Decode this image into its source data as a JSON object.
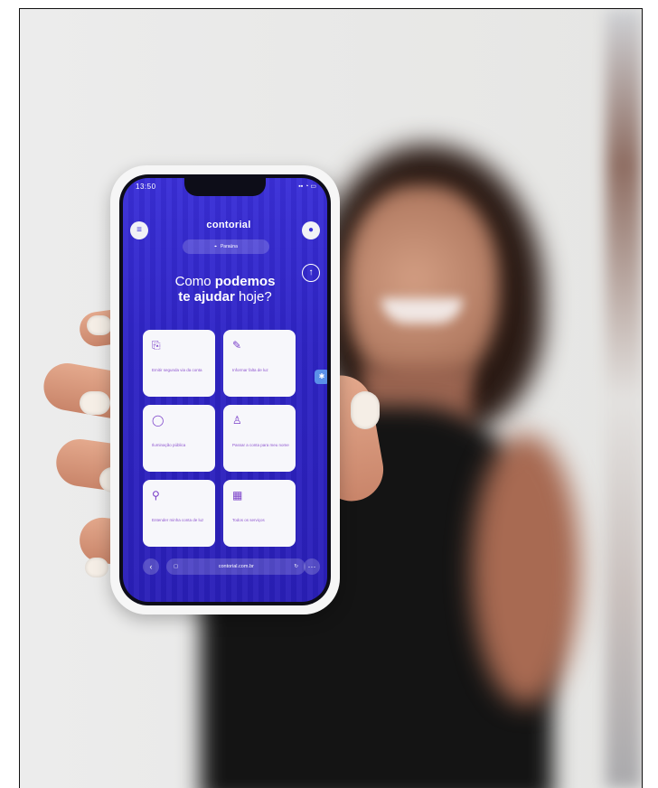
{
  "status_bar": {
    "time": "13:50",
    "icons": "▪▪ ◔ ▭"
  },
  "app": {
    "logo": "contorial",
    "location": "Paraúna",
    "headline_prefix": "Como",
    "headline_bold1": "podemos",
    "headline_bold2": "te ajudar",
    "headline_suffix": "hoje?"
  },
  "cards": [
    {
      "icon": "document-icon",
      "label": "Emitir segunda via da conta"
    },
    {
      "icon": "wrench-icon",
      "label": "Informar falta de luz"
    },
    {
      "icon": "lightbulb-icon",
      "label": "Iluminação pública"
    },
    {
      "icon": "people-icon",
      "label": "Passar a conta para meu nome"
    },
    {
      "icon": "pin-icon",
      "label": "Entender minha conta de luz"
    },
    {
      "icon": "grid-icon",
      "label": "Todos os serviços"
    }
  ],
  "browser": {
    "url": "contorial.com.br"
  },
  "colors": {
    "screen_bg": "#3a2fd8",
    "card_bg": "#f7f7fb",
    "card_text": "#8f56cf"
  }
}
